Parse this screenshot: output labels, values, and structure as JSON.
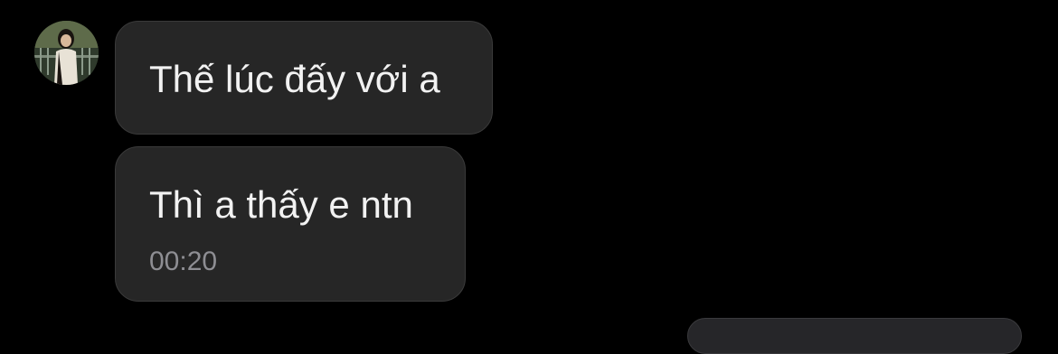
{
  "conversation": {
    "messages": [
      {
        "text": "Thế lúc đấy với a"
      },
      {
        "text": "Thì a thấy e ntn",
        "time": "00:20"
      }
    ]
  }
}
